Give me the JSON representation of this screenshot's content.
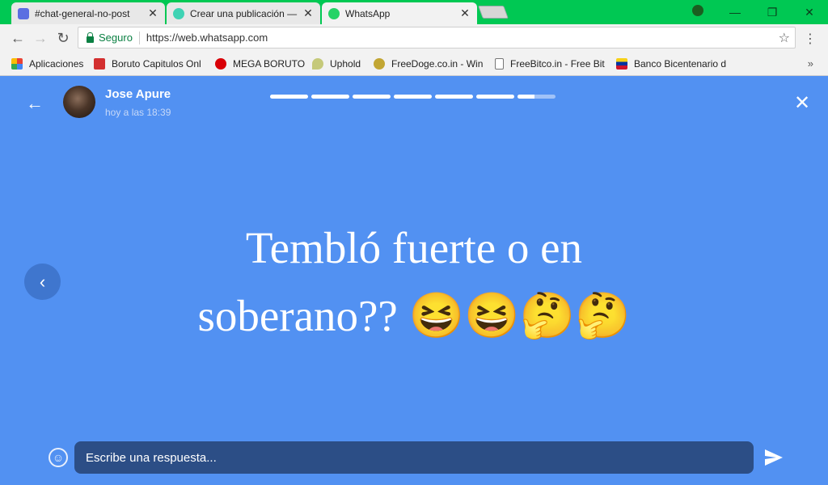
{
  "browser": {
    "tabs": [
      {
        "title": "#chat-general-no-post",
        "close": "✕",
        "favicon": "discord-icon",
        "color": "#5b6ee1"
      },
      {
        "title": "Crear una publicación —",
        "close": "✕",
        "favicon": "steemit-icon",
        "color": "#3ed3b4"
      },
      {
        "title": "WhatsApp",
        "close": "✕",
        "favicon": "whatsapp-icon",
        "color": "#25d366"
      }
    ],
    "window_controls": {
      "minimize": "—",
      "restore": "❐",
      "close": "✕"
    },
    "toolbar": {
      "back": "←",
      "forward": "→",
      "reload": "↻"
    },
    "address": {
      "secure_label": "Seguro",
      "url": "https://web.whatsapp.com",
      "star": "☆",
      "menu": "⋮"
    },
    "bookmarks": [
      {
        "label": "Aplicaciones",
        "icon": "apps-grid-icon",
        "color": "#e94235"
      },
      {
        "label": "Boruto Capitulos Onl",
        "icon": "boruto-icon",
        "color": "#d32f2f"
      },
      {
        "label": "MEGA BORUTO",
        "icon": "mega-icon",
        "color": "#d90007"
      },
      {
        "label": "Uphold",
        "icon": "uphold-icon",
        "color": "#c5c97a"
      },
      {
        "label": "FreeDoge.co.in - Win",
        "icon": "doge-icon",
        "color": "#c2a633"
      },
      {
        "label": "FreeBitco.in - Free Bit",
        "icon": "page-icon",
        "color": "#ffffff"
      },
      {
        "label": "Banco Bicentenario d",
        "icon": "venezuela-flag-icon",
        "color": "#f7d117"
      }
    ],
    "bookmarks_more": "»"
  },
  "status": {
    "contact_name": "Jose Apure",
    "timestamp": "hoy a las 18:39",
    "progress_segments": [
      1,
      1,
      1,
      1,
      1,
      1,
      0.45
    ],
    "text_line1": "Tembló fuerte o en",
    "text_line2": "soberano?? 😆😆🤔🤔",
    "reply_placeholder": "Escribe una respuesta...",
    "back_icon": "←",
    "close_icon": "✕",
    "prev_icon": "‹",
    "emoji_icon": "☺",
    "background_color": "#5291f2"
  }
}
